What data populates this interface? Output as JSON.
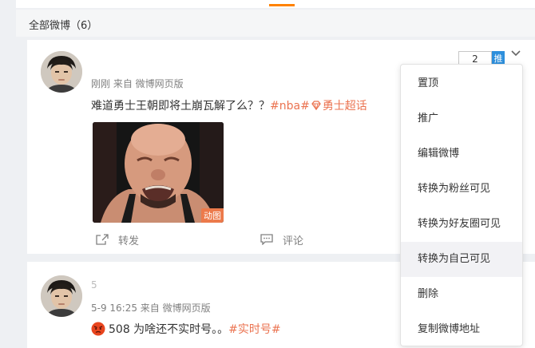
{
  "section": {
    "title": "全部微博（6）"
  },
  "post1": {
    "nickname": "",
    "meta": "刚刚 来自 微博网页版",
    "text_main": "难道勇士王朝即将土崩瓦解了么？？",
    "tag_nba": "#nba#",
    "tag_topic": "勇士超话",
    "gif_badge": "动图",
    "repost_label": "转发",
    "comment_label": "评论",
    "promo_value": "2",
    "promo_button": "推"
  },
  "post2": {
    "nickname": "5",
    "meta": "5-9 16:25 来自 微博网页版",
    "text_main": "508 为啥还不实时号。。",
    "tag": "#实时号#"
  },
  "menu": {
    "items": [
      "置顶",
      "推广",
      "编辑微博",
      "转换为粉丝可见",
      "转换为好友圈可见",
      "转换为自己可见",
      "删除",
      "复制微博地址"
    ],
    "highlighted_index": 5
  },
  "colors": {
    "accent": "#ff8200",
    "tag": "#eb7350",
    "button_blue": "#2d8fdc"
  }
}
